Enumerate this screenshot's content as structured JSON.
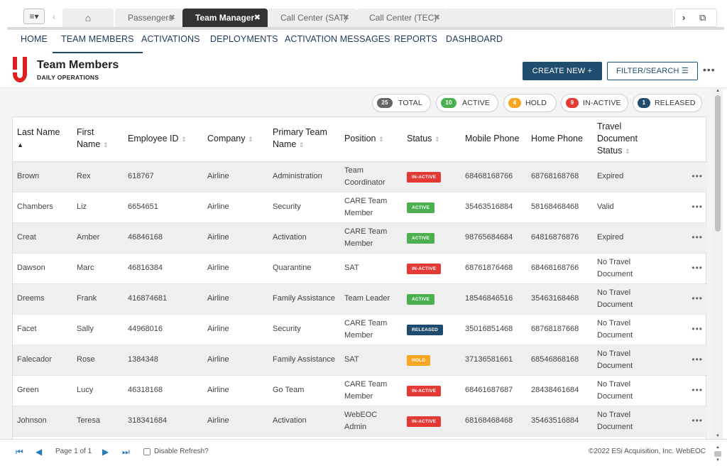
{
  "tabs": {
    "menu_label": "≡▾",
    "back_label": "‹",
    "home_label": "⌂",
    "items": [
      {
        "label": "Passengers"
      },
      {
        "label": "Team Manager"
      },
      {
        "label": "Call Center (SAT)"
      },
      {
        "label": "Call Center (TEC)"
      }
    ],
    "close_label": "✖",
    "forward_label": "›",
    "side_label": "⧉"
  },
  "nav": {
    "items": [
      {
        "label": "HOME"
      },
      {
        "label": "TEAM MEMBERS"
      },
      {
        "label": "ACTIVATIONS"
      },
      {
        "label": "DEPLOYMENTS"
      },
      {
        "label": "ACTIVATION MESSAGES"
      },
      {
        "label": "REPORTS"
      },
      {
        "label": "DASHBOARD"
      }
    ]
  },
  "header": {
    "title": "Team Members",
    "subtitle": "DAILY OPERATIONS",
    "create_label": "CREATE NEW +",
    "filter_label": "FILTER/SEARCH ☰",
    "more_label": "•••"
  },
  "summary": [
    {
      "count": "25",
      "label": "TOTAL",
      "color": "#666666"
    },
    {
      "count": "10",
      "label": "ACTIVE",
      "color": "#4caf50"
    },
    {
      "count": "4",
      "label": "HOLD",
      "color": "#f5a623"
    },
    {
      "count": "9",
      "label": "IN-ACTIVE",
      "color": "#e53935"
    },
    {
      "count": "1",
      "label": "RELEASED",
      "color": "#1e4b6e"
    }
  ],
  "columns": {
    "last_name": "Last Name",
    "first_name": "First Name",
    "employee_id": "Employee ID",
    "company": "Company",
    "primary_team": "Primary Team Name",
    "position": "Position",
    "status": "Status",
    "mobile": "Mobile Phone",
    "home": "Home Phone",
    "travel": "Travel Document Status"
  },
  "status_colors": {
    "IN-ACTIVE": "#e53935",
    "ACTIVE": "#4caf50",
    "RELEASED": "#1e4b6e",
    "HOLD": "#f5a623"
  },
  "rows": [
    {
      "last": "Brown",
      "first": "Rex",
      "emp": "618767",
      "company": "Airline",
      "team": "Administration",
      "position": "Team Coordinator",
      "status": "IN-ACTIVE",
      "mobile": "68468168766",
      "home": "68768168768",
      "travel": "Expired"
    },
    {
      "last": "Chambers",
      "first": "Liz",
      "emp": "6654651",
      "company": "Airline",
      "team": "Security",
      "position": "CARE Team Member",
      "status": "ACTIVE",
      "mobile": "35463516884",
      "home": "58168468468",
      "travel": "Valid"
    },
    {
      "last": "Creat",
      "first": "Amber",
      "emp": "46846168",
      "company": "Airline",
      "team": "Activation",
      "position": "CARE Team Member",
      "status": "ACTIVE",
      "mobile": "98765684684",
      "home": "64816876876",
      "travel": "Expired"
    },
    {
      "last": "Dawson",
      "first": "Marc",
      "emp": "46816384",
      "company": "Airline",
      "team": "Quarantine",
      "position": "SAT",
      "status": "IN-ACTIVE",
      "mobile": "68761876468",
      "home": "68468168766",
      "travel": "No Travel Document"
    },
    {
      "last": "Dreems",
      "first": "Frank",
      "emp": "416874681",
      "company": "Airline",
      "team": "Family Assistance",
      "position": "Team Leader",
      "status": "ACTIVE",
      "mobile": "18546846516",
      "home": "35463168468",
      "travel": "No Travel Document"
    },
    {
      "last": "Facet",
      "first": "Sally",
      "emp": "44968016",
      "company": "Airline",
      "team": "Security",
      "position": "CARE Team Member",
      "status": "RELEASED",
      "mobile": "35016851468",
      "home": "68768187668",
      "travel": "No Travel Document"
    },
    {
      "last": "Falecador",
      "first": "Rose",
      "emp": "1384348",
      "company": "Airline",
      "team": "Family Assistance",
      "position": "SAT",
      "status": "HOLD",
      "mobile": "37136581661",
      "home": "68546868168",
      "travel": "No Travel Document"
    },
    {
      "last": "Green",
      "first": "Lucy",
      "emp": "46318168",
      "company": "Airline",
      "team": "Go Team",
      "position": "CARE Team Member",
      "status": "IN-ACTIVE",
      "mobile": "68461687687",
      "home": "28438461684",
      "travel": "No Travel Document"
    },
    {
      "last": "Johnson",
      "first": "Teresa",
      "emp": "318341684",
      "company": "Airline",
      "team": "Activation",
      "position": "WebEOC Admin",
      "status": "IN-ACTIVE",
      "mobile": "68168468468",
      "home": "35463516884",
      "travel": "No Travel Document"
    }
  ],
  "row_more_label": "•••",
  "footer": {
    "page_info": "Page 1 of 1",
    "refresh_label": "Disable Refresh?",
    "copyright": "©2022 ESi Acquisition, Inc. WebEOC"
  }
}
